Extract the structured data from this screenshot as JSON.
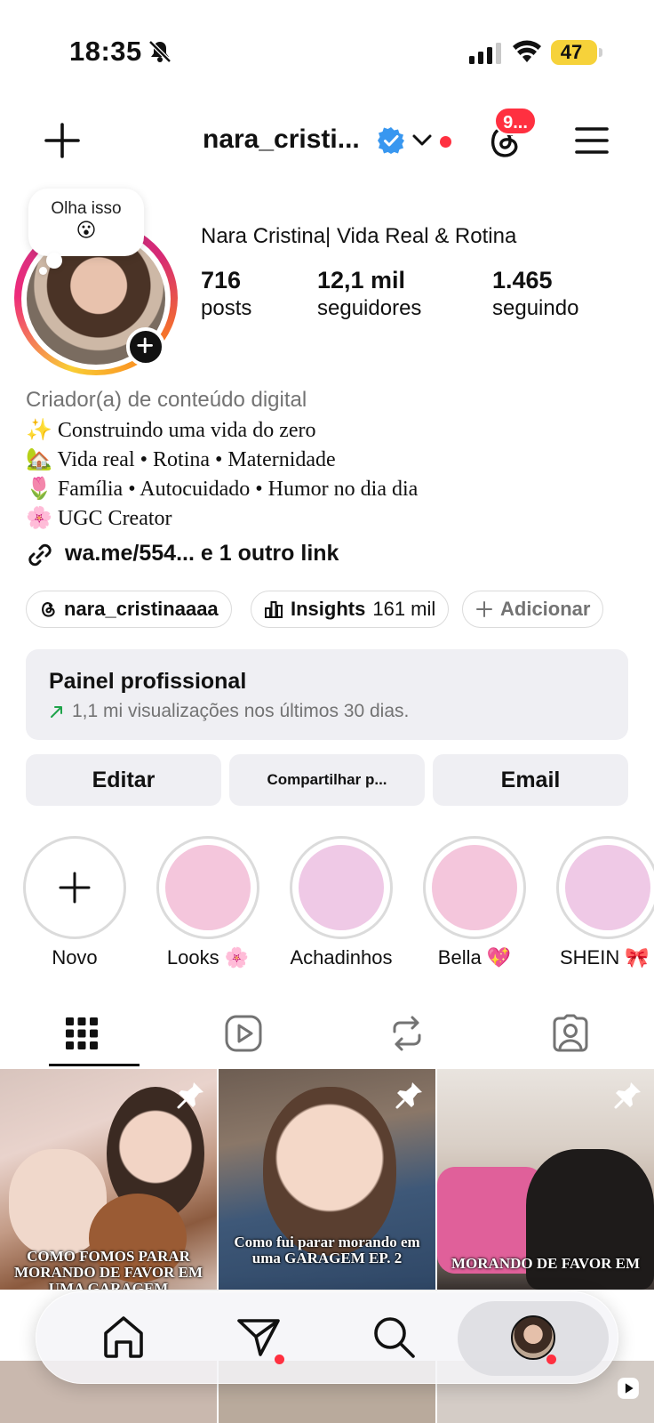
{
  "status_bar": {
    "time": "18:35",
    "battery": "47"
  },
  "header": {
    "username": "nara_cristi...",
    "threads_badge": "9...",
    "accent_red": "#ff3040",
    "verified_color": "#3897f0"
  },
  "profile": {
    "note_text": "Olha isso",
    "note_emoji": "😮",
    "display_name": "Nara Cristina| Vida Real & Rotina",
    "stats": [
      {
        "value": "716",
        "label": "posts"
      },
      {
        "value": "12,1 mil",
        "label": "seguidores"
      },
      {
        "value": "1.465",
        "label": "seguindo"
      }
    ],
    "category": "Criador(a) de conteúdo digital",
    "bio_lines": [
      "✨ Construindo uma vida do zero",
      "🏡 Vida real • Rotina • Maternidade",
      "🌷 Família • Autocuidado • Humor no dia dia",
      "🌸 UGC Creator"
    ],
    "link_text": "wa.me/554... e 1 outro link"
  },
  "chips": {
    "threads_handle": "nara_cristinaaaa",
    "insights_label": "Insights",
    "insights_value": "161 mil",
    "add_label": "Adicionar"
  },
  "pro_panel": {
    "title": "Painel profissional",
    "subtitle": "1,1 mi visualizações nos últimos 30 dias.",
    "arrow_color": "#1fa34a"
  },
  "actions": {
    "edit": "Editar",
    "share": "Compartilhar p...",
    "email": "Email"
  },
  "highlights": [
    {
      "label": "Novo",
      "icon": "plus-icon"
    },
    {
      "label": "Looks 🌸",
      "color": "#f4c6dc"
    },
    {
      "label": "Achadinhos",
      "color": "#efc9e6"
    },
    {
      "label": "Bella 💖",
      "color": "#f4c6dc"
    },
    {
      "label": "SHEIN 🎀",
      "color": "#efc9e6"
    }
  ],
  "tabs": [
    "grid-icon",
    "reels-icon",
    "reposts-icon",
    "tagged-icon"
  ],
  "posts": [
    {
      "caption": "COMO FOMOS PARAR MORANDO DE FAVOR EM UMA GARAGEM",
      "pinned": true
    },
    {
      "caption": "Como fui parar morando em uma GARAGEM EP. 2",
      "pinned": true
    },
    {
      "caption": "MORANDO DE FAVOR EM",
      "pinned": true
    }
  ],
  "bottom_nav": [
    "home-icon",
    "direct-icon",
    "search-icon",
    "profile-avatar"
  ]
}
